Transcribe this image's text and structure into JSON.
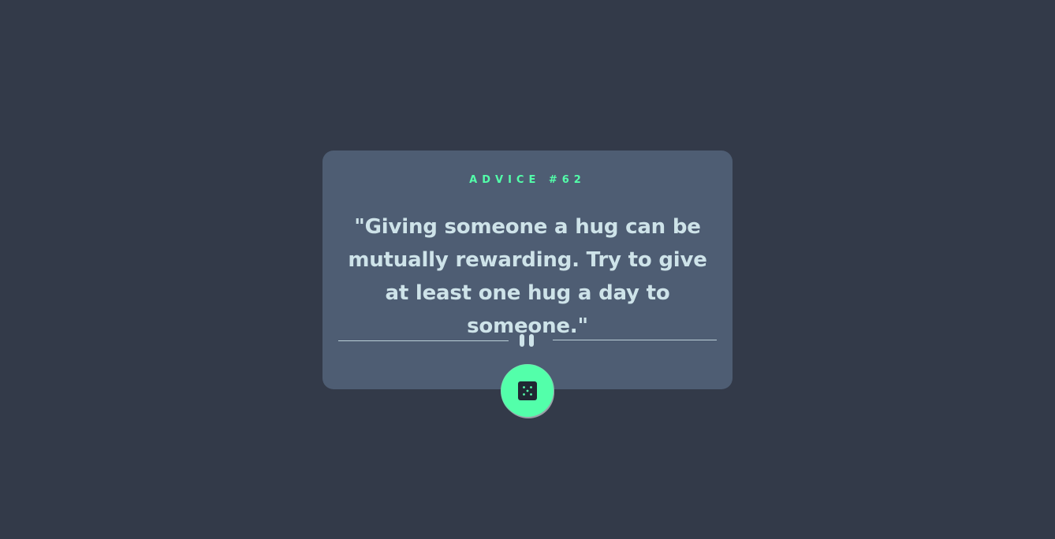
{
  "card": {
    "advice_label": "ADVICE #62",
    "quote": "\"Giving someone a hug can be mutually rewarding. Try to give at least one hug a day to someone.\""
  },
  "divider": {
    "icon": "pause-icon"
  },
  "generate_button": {
    "icon": "dice-icon",
    "accent_color": "#53ffaa"
  },
  "colors": {
    "background": "#333a49",
    "card": "#4e5d73",
    "accent": "#53ffaa",
    "text": "#cee3e9"
  }
}
